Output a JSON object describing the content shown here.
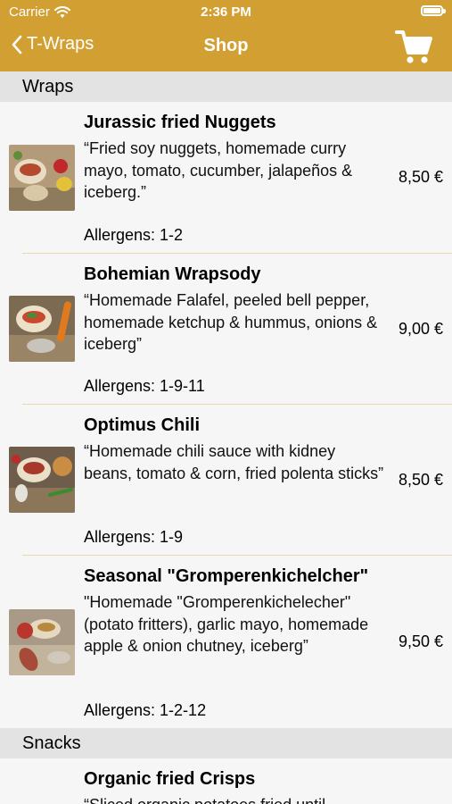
{
  "status": {
    "carrier": "Carrier",
    "time": "2:36 PM"
  },
  "nav": {
    "back_label": "T-Wraps",
    "title": "Shop"
  },
  "sections": [
    {
      "title": "Wraps"
    },
    {
      "title": "Snacks"
    }
  ],
  "items": [
    {
      "name": "Jurassic fried Nuggets",
      "desc": "“Fried soy nuggets, homemade curry mayo, tomato, cucumber, jalapeños & iceberg.”",
      "price": "8,50 €",
      "allergens": "Allergens: 1-2"
    },
    {
      "name": "Bohemian Wrapsody",
      "desc": "“Homemade Falafel, peeled bell pepper, homemade ketchup & hummus, onions & iceberg”",
      "price": "9,00 €",
      "allergens": "Allergens: 1-9-11"
    },
    {
      "name": "Optimus Chili",
      "desc": "“Homemade chili sauce with kidney beans, tomato & corn, fried polenta sticks”",
      "price": "8,50 €",
      "allergens": "Allergens: 1-9"
    },
    {
      "name": "Seasonal \"Gromperenkichelcher\"",
      "desc": "\"Homemade \"Gromperenkichelecher\" (potato fritters), garlic mayo, homemade apple & onion chutney, iceberg”",
      "price": "9,50 €",
      "allergens": "Allergens: 1-2-12"
    },
    {
      "name": "Organic fried Crisps",
      "desc": "“Sliced organic potatoes fried until"
    }
  ],
  "colors": {
    "brand": "#d2a032",
    "section_bg": "#e3e3e3",
    "divider": "#e8d6ae"
  },
  "icons": {
    "back": "chevron-left-icon",
    "cart": "shopping-cart-icon",
    "wifi": "wifi-icon",
    "battery": "battery-icon"
  }
}
